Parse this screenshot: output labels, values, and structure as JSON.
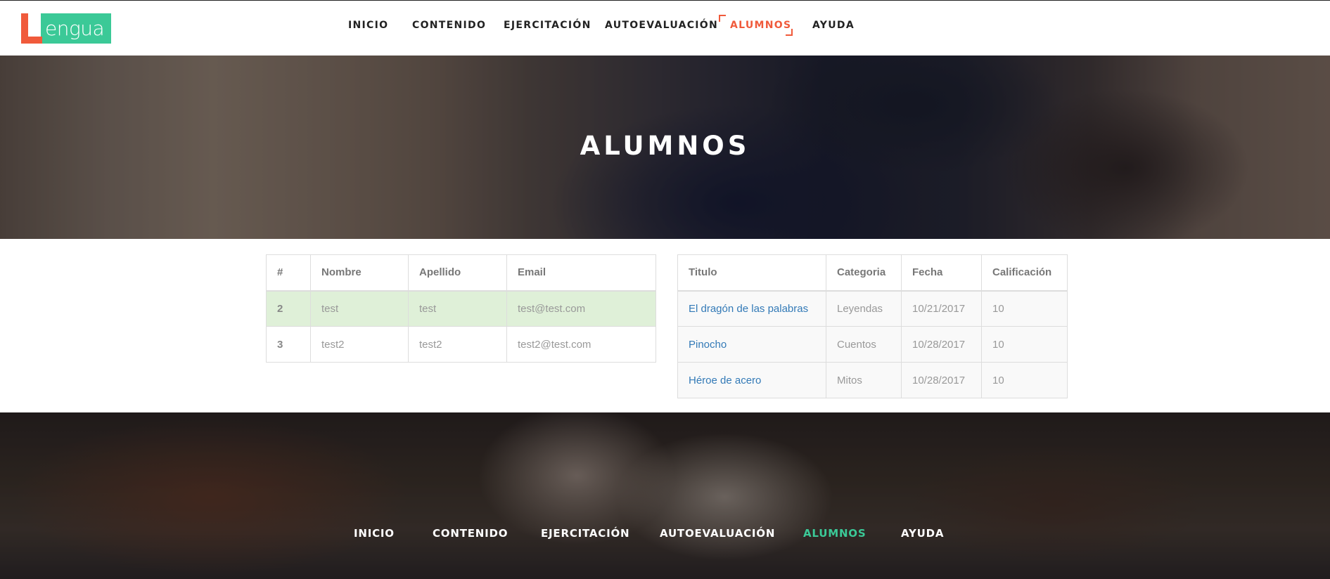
{
  "logo": {
    "letter": "L",
    "text": "engua"
  },
  "nav": {
    "items": [
      {
        "label": "INICIO"
      },
      {
        "label": "CONTENIDO"
      },
      {
        "label": "EJERCITACIÓN"
      },
      {
        "label": "AUTOEVALUACIÓN"
      },
      {
        "label": "ALUMNOS",
        "active": true
      },
      {
        "label": "AYUDA"
      }
    ]
  },
  "hero": {
    "title": "ALUMNOS"
  },
  "students_table": {
    "headers": [
      "#",
      "Nombre",
      "Apellido",
      "Email"
    ],
    "rows": [
      {
        "id": "2",
        "nombre": "test",
        "apellido": "test",
        "email": "test@test.com",
        "highlighted": true
      },
      {
        "id": "3",
        "nombre": "test2",
        "apellido": "test2",
        "email": "test2@test.com"
      }
    ]
  },
  "results_table": {
    "headers": [
      "Titulo",
      "Categoria",
      "Fecha",
      "Calificación"
    ],
    "rows": [
      {
        "titulo": "El dragón de las palabras",
        "categoria": "Leyendas",
        "fecha": "10/21/2017",
        "calificacion": "10"
      },
      {
        "titulo": "Pinocho",
        "categoria": "Cuentos",
        "fecha": "10/28/2017",
        "calificacion": "10"
      },
      {
        "titulo": "Héroe de acero",
        "categoria": "Mitos",
        "fecha": "10/28/2017",
        "calificacion": "10"
      }
    ]
  },
  "footer_nav": {
    "items": [
      {
        "label": "INICIO"
      },
      {
        "label": "CONTENIDO"
      },
      {
        "label": "EJERCITACIÓN"
      },
      {
        "label": "AUTOEVALUACIÓN"
      },
      {
        "label": "ALUMNOS",
        "active": true
      },
      {
        "label": "AYUDA"
      }
    ]
  },
  "colors": {
    "accent_orange": "#f05a3b",
    "accent_green": "#3bc997",
    "link": "#337ab7",
    "success_row": "#dff0d8"
  }
}
